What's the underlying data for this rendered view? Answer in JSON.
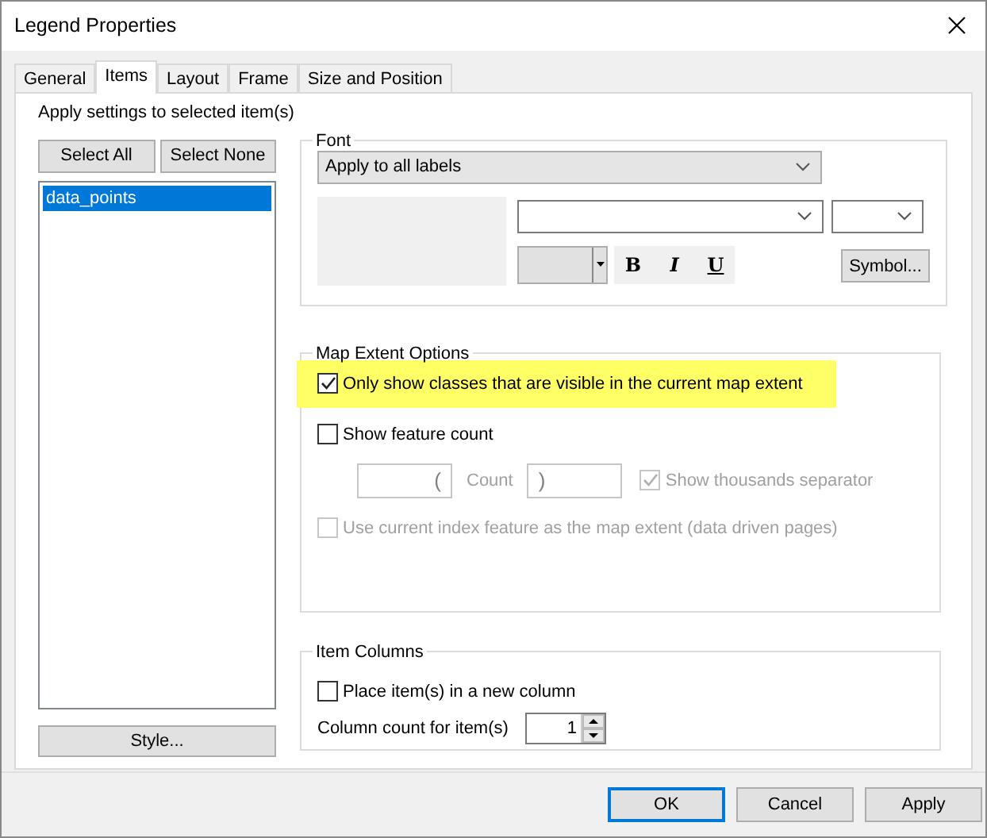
{
  "window": {
    "title": "Legend Properties"
  },
  "tabs": [
    {
      "label": "General",
      "selected": false
    },
    {
      "label": "Items",
      "selected": true
    },
    {
      "label": "Layout",
      "selected": false
    },
    {
      "label": "Frame",
      "selected": false
    },
    {
      "label": "Size and Position",
      "selected": false
    }
  ],
  "items_panel": {
    "caption": "Apply settings to selected item(s)",
    "buttons": [
      "Select All",
      "Select None"
    ],
    "items": [
      {
        "label": "data_points",
        "selected": true
      }
    ],
    "style_button": "Style..."
  },
  "font": {
    "title": "Font",
    "apply_dropdown": "Apply to all labels",
    "style_buttons": [
      {
        "label": "B",
        "kind": "bold"
      },
      {
        "label": "I",
        "kind": "italic"
      },
      {
        "label": "U",
        "kind": "underline"
      }
    ],
    "symbol_button": "Symbol..."
  },
  "map_extent": {
    "title": "Map Extent Options",
    "options": [
      {
        "label": "Only show classes that are visible in the current map extent",
        "checked": true,
        "disabled": false,
        "highlighted": true
      },
      {
        "label": "Show feature count",
        "checked": false,
        "disabled": false,
        "highlighted": false
      }
    ],
    "count": {
      "prefix": "(",
      "label": "Count",
      "suffix": ")",
      "thousands": {
        "label": "Show thousands separator",
        "checked": true,
        "disabled": true
      }
    },
    "index_option": {
      "label": "Use current index feature as the map extent (data driven pages)",
      "checked": false,
      "disabled": true
    }
  },
  "item_columns": {
    "title": "Item Columns",
    "new_column": {
      "label": "Place item(s) in a new column",
      "checked": false
    },
    "count_label": "Column count for item(s)",
    "count_value": "1"
  },
  "buttons": [
    {
      "label": "OK",
      "default": true
    },
    {
      "label": "Cancel",
      "default": false
    },
    {
      "label": "Apply",
      "default": false
    }
  ]
}
